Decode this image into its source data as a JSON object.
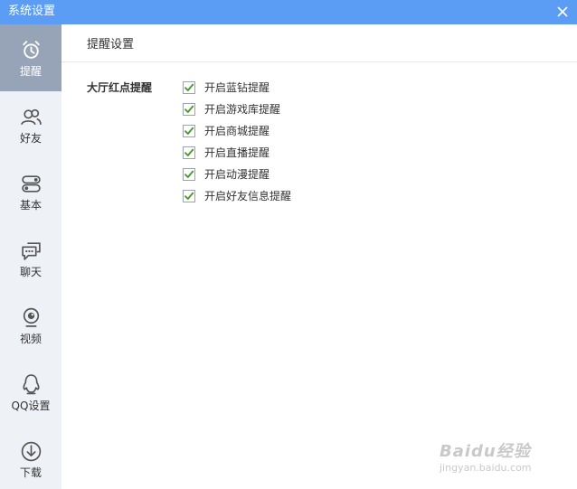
{
  "window": {
    "title": "系统设置"
  },
  "sidebar": {
    "items": [
      {
        "label": "提醒",
        "icon": "alarm-clock-icon",
        "active": true
      },
      {
        "label": "好友",
        "icon": "friends-icon",
        "active": false
      },
      {
        "label": "基本",
        "icon": "basic-settings-icon",
        "active": false
      },
      {
        "label": "聊天",
        "icon": "chat-icon",
        "active": false
      },
      {
        "label": "视频",
        "icon": "camera-icon",
        "active": false
      },
      {
        "label": "QQ设置",
        "icon": "penguin-icon",
        "active": false
      },
      {
        "label": "下载",
        "icon": "download-icon",
        "active": false
      }
    ]
  },
  "main": {
    "section_title": "提醒设置",
    "group_label": "大厅红点提醒",
    "options": [
      {
        "label": "开启蓝钻提醒",
        "checked": true
      },
      {
        "label": "开启游戏库提醒",
        "checked": true
      },
      {
        "label": "开启商城提醒",
        "checked": true
      },
      {
        "label": "开启直播提醒",
        "checked": true
      },
      {
        "label": "开启动漫提醒",
        "checked": true
      },
      {
        "label": "开启好友信息提醒",
        "checked": true
      }
    ]
  },
  "watermark": {
    "text": "Baidu经验",
    "url": "jingyan.baidu.com"
  },
  "colors": {
    "titlebar": "#5b9cf5",
    "sidebar_bg": "#eef1f6",
    "sidebar_active": "#97a3b6",
    "check": "#4a9a2a"
  }
}
